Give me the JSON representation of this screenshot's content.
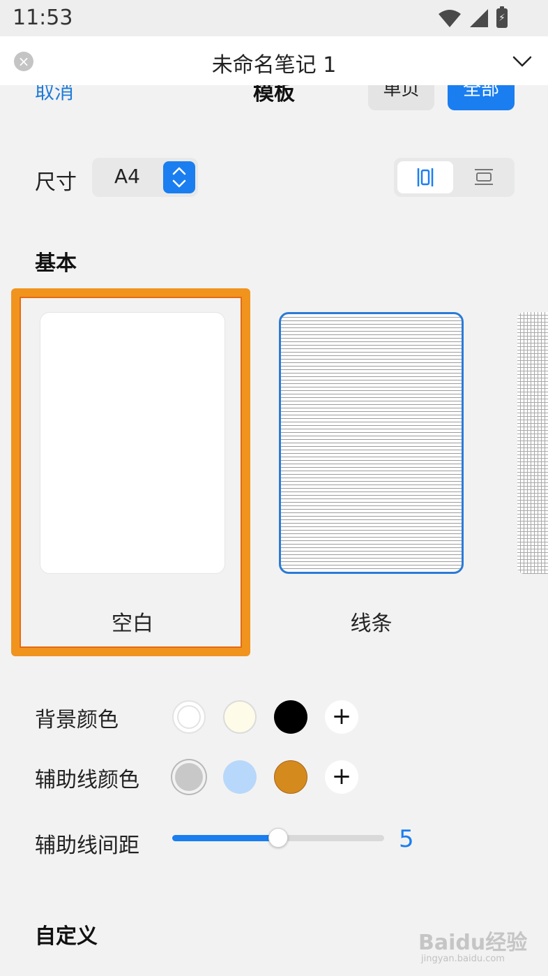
{
  "status_bar": {
    "time": "11:53"
  },
  "title_bar": {
    "title": "未命名笔记 1"
  },
  "template_panel": {
    "cancel": "取消",
    "title": "模板",
    "scope_options": [
      "单页",
      "全部"
    ],
    "scope_selected": "全部"
  },
  "size": {
    "label": "尺寸",
    "value": "A4",
    "orientation_selected": "portrait"
  },
  "basic": {
    "heading": "基本",
    "templates": [
      {
        "label": "空白",
        "selected": true
      },
      {
        "label": "线条",
        "selected": false
      },
      {
        "label": "",
        "selected": false
      }
    ]
  },
  "background_color": {
    "label": "背景颜色",
    "swatches": [
      "#ffffff",
      "#fffbe9",
      "#000000"
    ]
  },
  "guide_color": {
    "label": "辅助线颜色",
    "swatches": [
      "#c8c8c8",
      "#b7d8fb",
      "#d58a1e"
    ]
  },
  "guide_spacing": {
    "label": "辅助线间距",
    "value": "5",
    "level": 0.5
  },
  "custom": {
    "heading": "自定义"
  },
  "watermark": {
    "text": "Baidu经验",
    "sub": "jingyan.baidu.com"
  },
  "colors": {
    "accent": "#1a7ef0",
    "selection_frame": "#f0941e"
  }
}
